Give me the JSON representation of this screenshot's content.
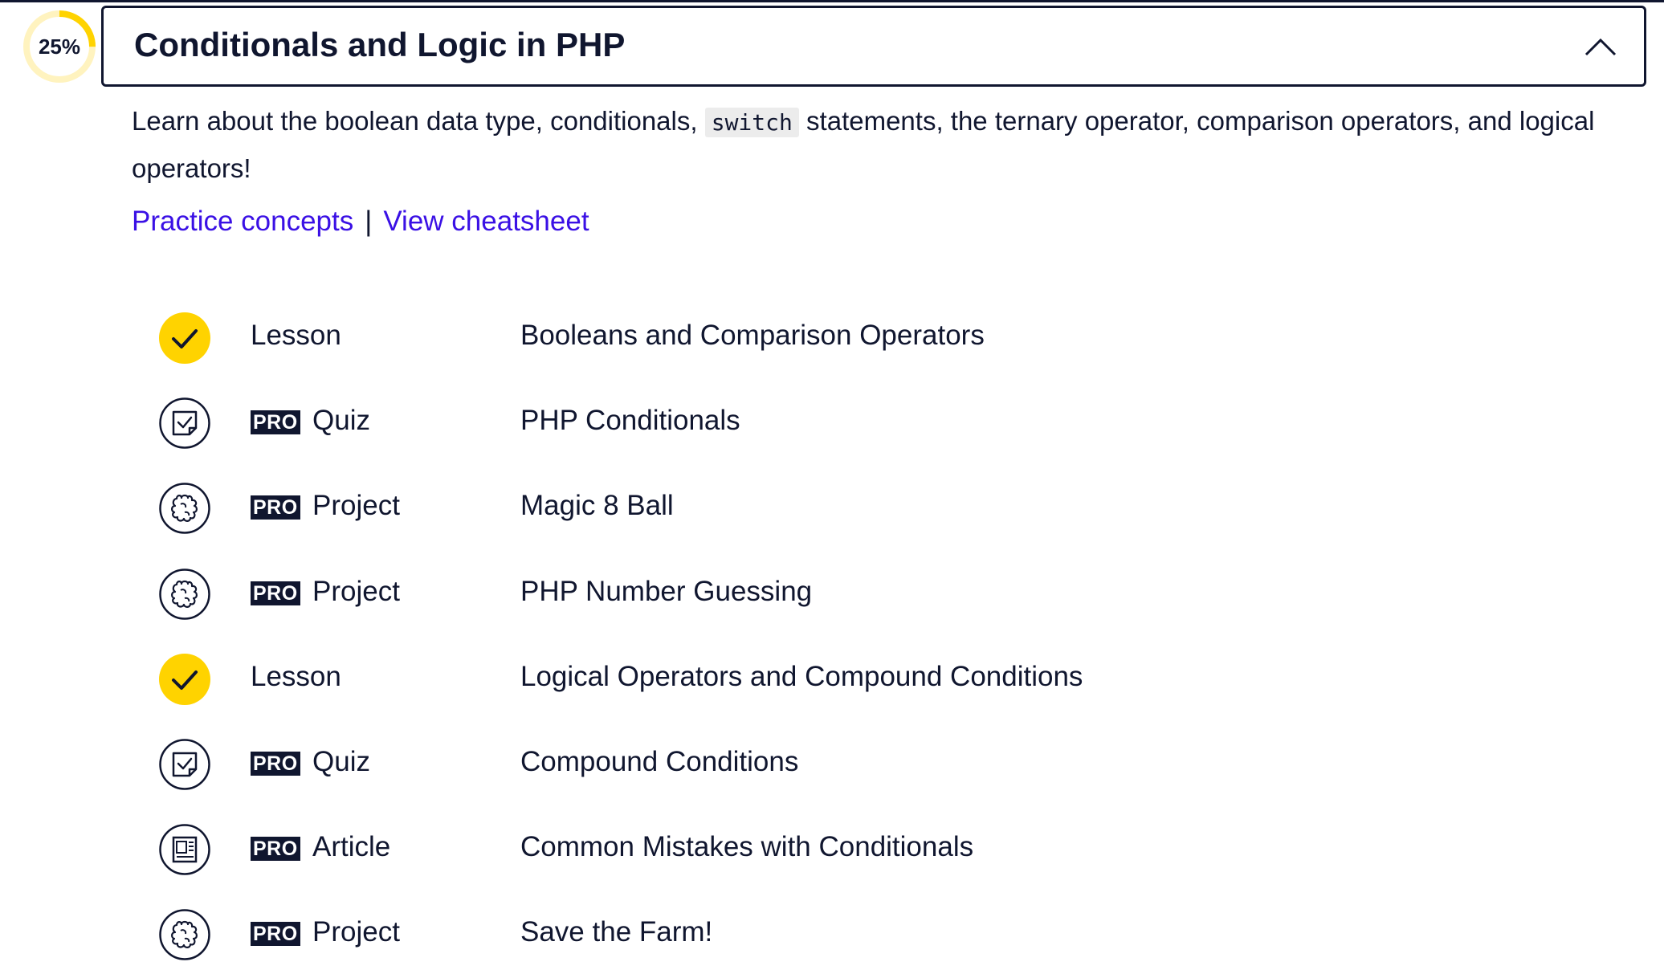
{
  "progress": {
    "percent_label": "25%",
    "fraction": 0.25,
    "color": "#ffd300",
    "track_color": "#fff3bf"
  },
  "module": {
    "title": "Conditionals and Logic in PHP",
    "collapse_icon": "chevron-up-icon",
    "description_before": "Learn about the boolean data type, conditionals,",
    "description_code": "switch",
    "description_after": "statements, the ternary operator, comparison operators, and logical operators!"
  },
  "links": {
    "practice": "Practice concepts",
    "separator": "|",
    "cheatsheet": "View cheatsheet",
    "color": "#3a10e5"
  },
  "items": [
    {
      "status": "completed",
      "icon": "check-icon",
      "pro": false,
      "pro_label": "",
      "type": "Lesson",
      "title": "Booleans and Comparison Operators"
    },
    {
      "status": "incomplete",
      "icon": "quiz-icon",
      "pro": true,
      "pro_label": "PRO",
      "type": "Quiz",
      "title": "PHP Conditionals"
    },
    {
      "status": "incomplete",
      "icon": "puzzle-icon",
      "pro": true,
      "pro_label": "PRO",
      "type": "Project",
      "title": "Magic 8 Ball"
    },
    {
      "status": "incomplete",
      "icon": "puzzle-icon",
      "pro": true,
      "pro_label": "PRO",
      "type": "Project",
      "title": "PHP Number Guessing"
    },
    {
      "status": "completed",
      "icon": "check-icon",
      "pro": false,
      "pro_label": "",
      "type": "Lesson",
      "title": "Logical Operators and Compound Conditions"
    },
    {
      "status": "incomplete",
      "icon": "quiz-icon",
      "pro": true,
      "pro_label": "PRO",
      "type": "Quiz",
      "title": "Compound Conditions"
    },
    {
      "status": "incomplete",
      "icon": "article-icon",
      "pro": true,
      "pro_label": "PRO",
      "type": "Article",
      "title": "Common Mistakes with Conditionals"
    },
    {
      "status": "incomplete",
      "icon": "puzzle-icon",
      "pro": true,
      "pro_label": "PRO",
      "type": "Project",
      "title": "Save the Farm!"
    }
  ]
}
